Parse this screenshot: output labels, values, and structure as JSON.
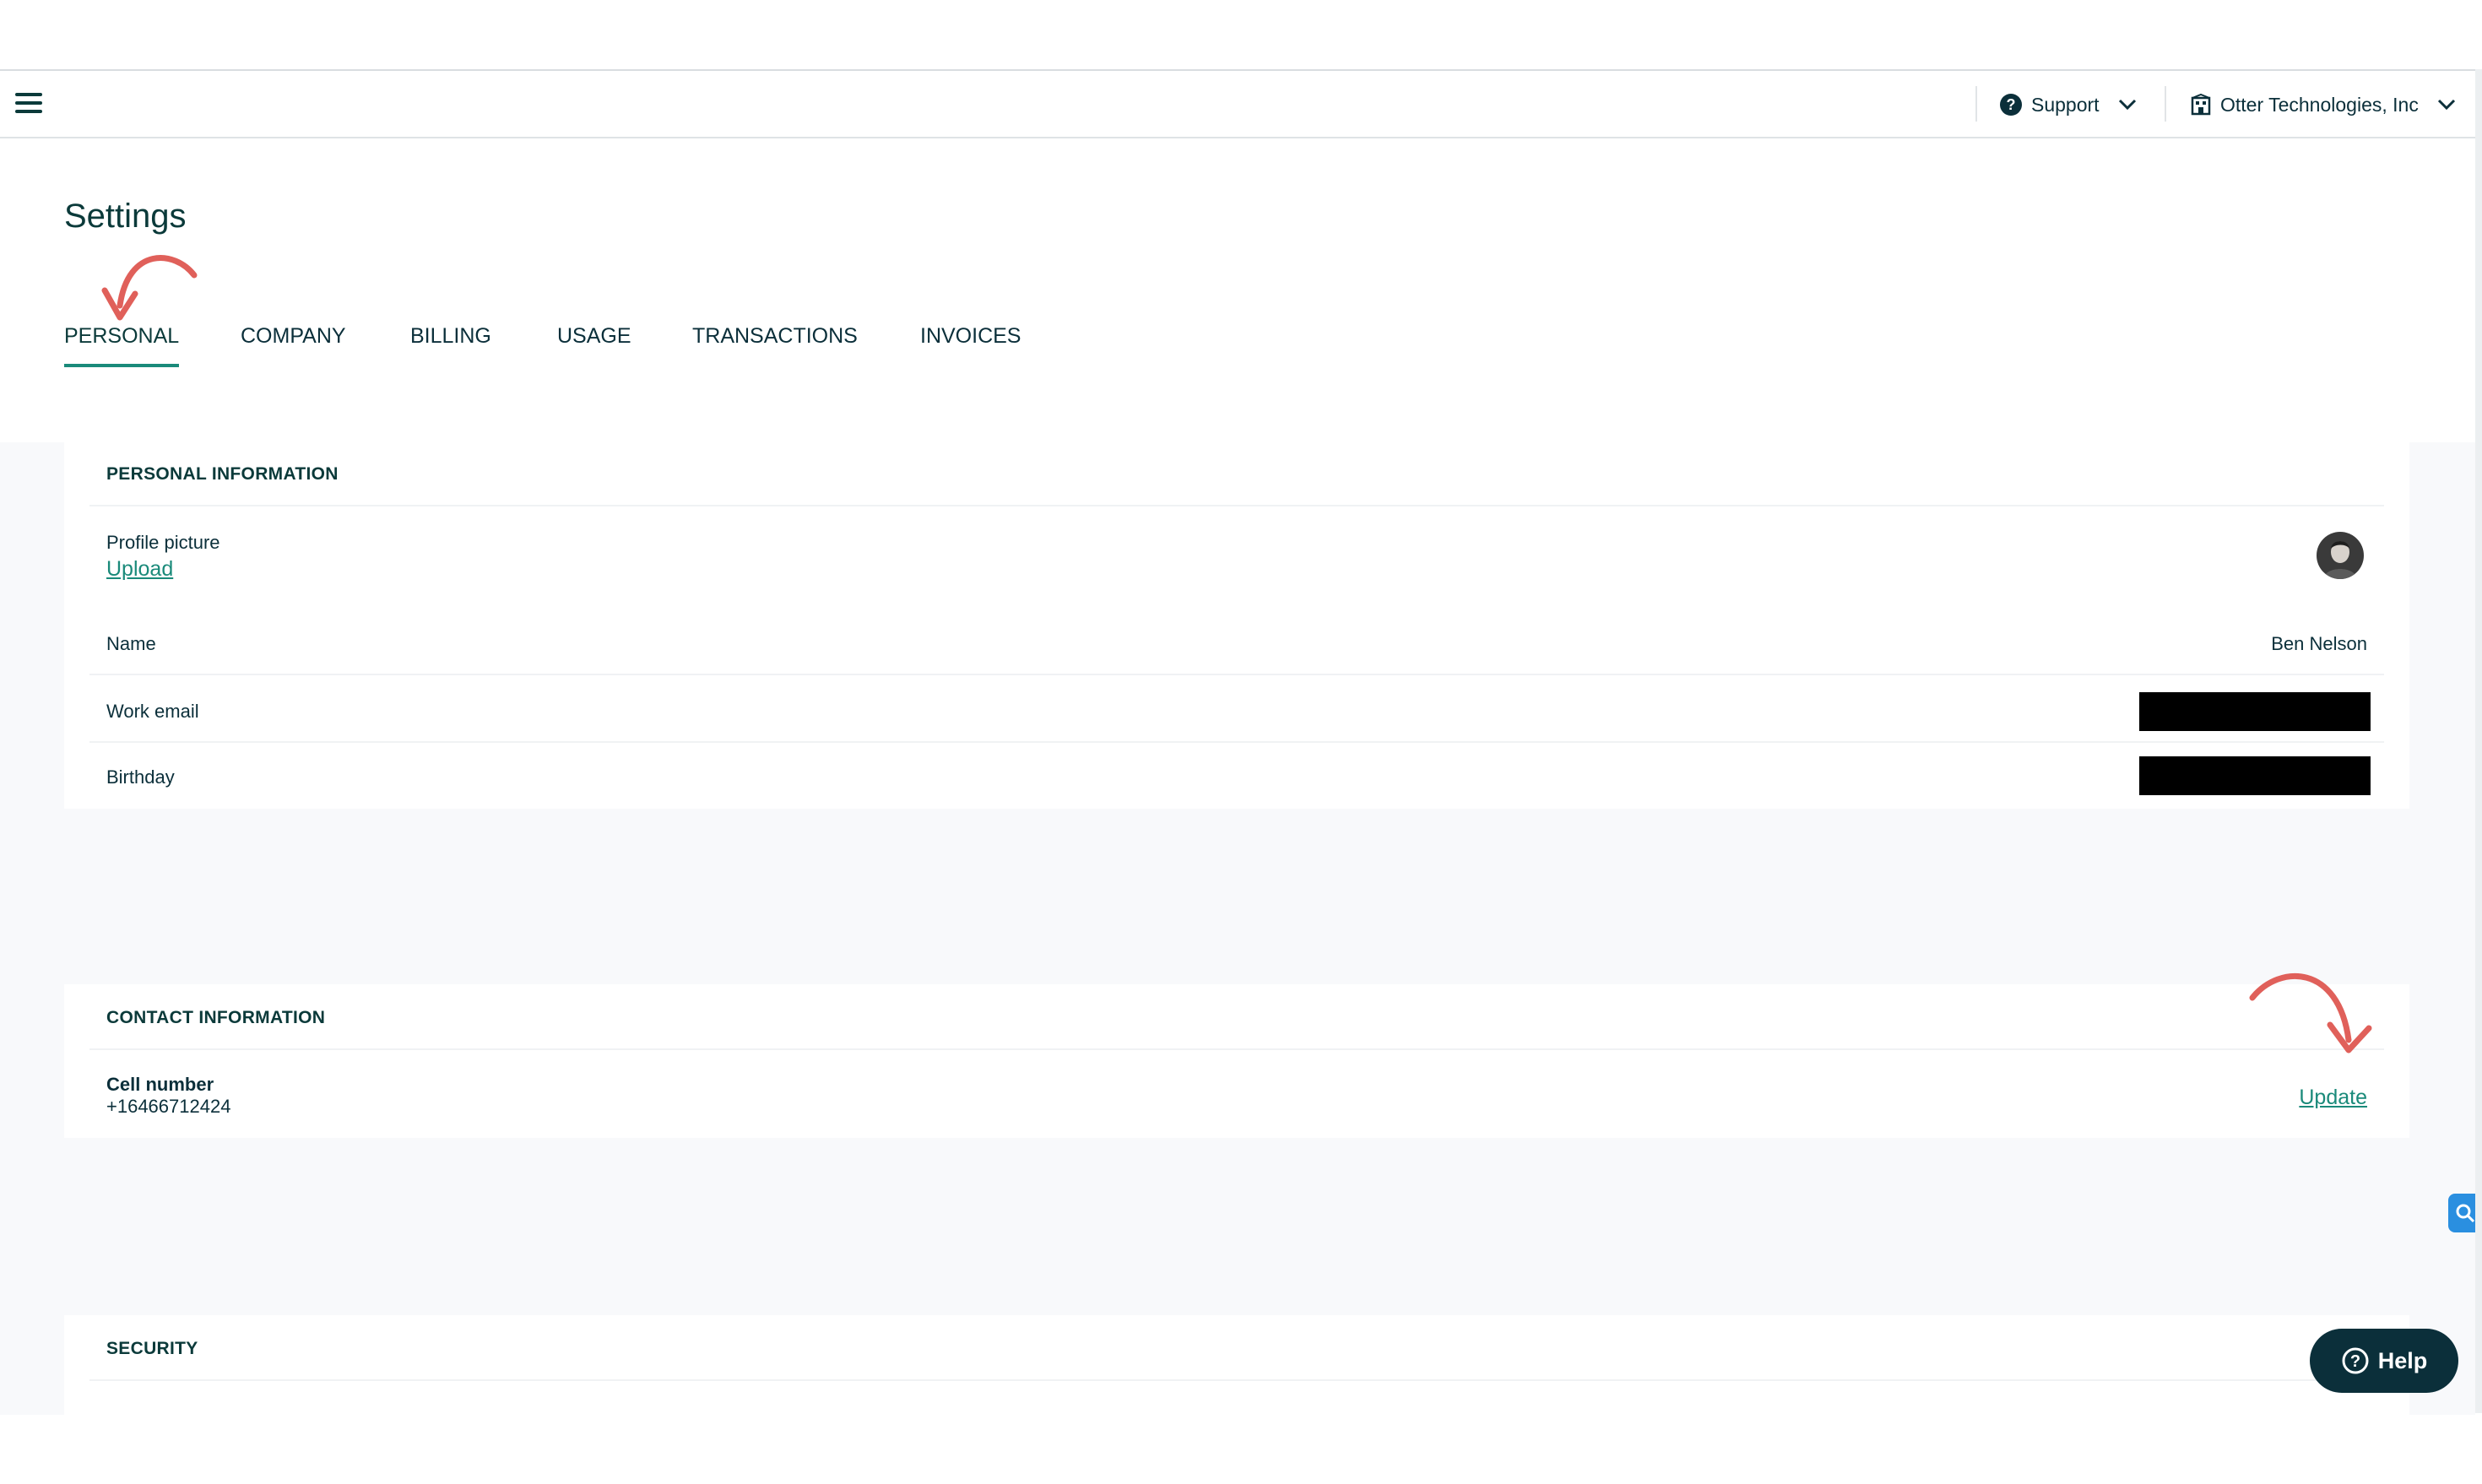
{
  "topbar": {
    "support_label": "Support",
    "org_label": "Otter Technologies, Inc"
  },
  "page": {
    "title": "Settings",
    "tabs": [
      {
        "label": "PERSONAL",
        "active": true
      },
      {
        "label": "COMPANY",
        "active": false
      },
      {
        "label": "BILLING",
        "active": false
      },
      {
        "label": "USAGE",
        "active": false
      },
      {
        "label": "TRANSACTIONS",
        "active": false
      },
      {
        "label": "INVOICES",
        "active": false
      }
    ]
  },
  "personal": {
    "title": "PERSONAL INFORMATION",
    "profile_label": "Profile picture",
    "upload_label": "Upload",
    "name_label": "Name",
    "name_value": "Ben Nelson",
    "email_label": "Work email",
    "birthday_label": "Birthday"
  },
  "contact": {
    "title": "CONTACT INFORMATION",
    "cell_label": "Cell number",
    "cell_value": "+16466712424",
    "update_label": "Update"
  },
  "security": {
    "title": "SECURITY"
  },
  "help": {
    "label": "Help"
  },
  "colors": {
    "accent": "#1a8a7a",
    "text_dark": "#0b3a3a",
    "annotation_arrow": "#e0605a",
    "help_button": "#0b2f3a",
    "side_tool": "#2a8fe0"
  },
  "icons": [
    "menu-icon",
    "help-circle-icon",
    "chevron-down-icon",
    "building-icon",
    "magnifier-icon"
  ]
}
